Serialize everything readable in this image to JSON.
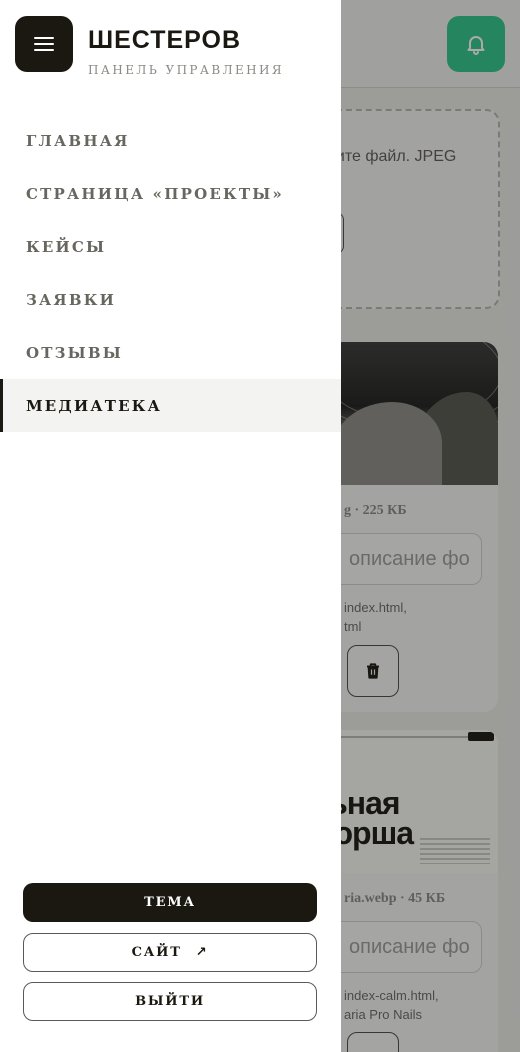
{
  "brand": {
    "title": "ШЕСТЕРОВ",
    "subtitle": "ПАНЕЛЬ УПРАВЛЕНИЯ"
  },
  "nav": {
    "items": [
      {
        "label": "ГЛАВНАЯ",
        "active": false
      },
      {
        "label": "СТРАНИЦА «ПРОЕКТЫ»",
        "active": false
      },
      {
        "label": "КЕЙСЫ",
        "active": false
      },
      {
        "label": "ЗАЯВКИ",
        "active": false
      },
      {
        "label": "ОТЗЫВЫ",
        "active": false
      },
      {
        "label": "МЕДИАТЕКА",
        "active": true
      }
    ]
  },
  "footer": {
    "theme_label": "ТЕМА",
    "site_label": "САЙТ",
    "site_icon": "external-arrow-icon",
    "logout_label": "ВЫЙТИ"
  },
  "background": {
    "upload_hint": "рите файл. JPEG\nP.",
    "cards": [
      {
        "meta": "g · 225 КБ",
        "description_placeholder": "описание фо",
        "usage": "index.html,\ntml"
      },
      {
        "meta": "ria.webp · 45 КБ",
        "description_placeholder": "описание фо",
        "usage": "index-calm.html,\naria Pro Nails",
        "preview_headline": "альная\nикюрша"
      }
    ]
  },
  "colors": {
    "accent_green": "#2fc58a",
    "dark": "#1b1812",
    "overlay": "rgba(20,20,18,0.36)"
  },
  "icons": [
    "menu-icon",
    "bell-icon",
    "trash-icon",
    "external-arrow-icon"
  ]
}
